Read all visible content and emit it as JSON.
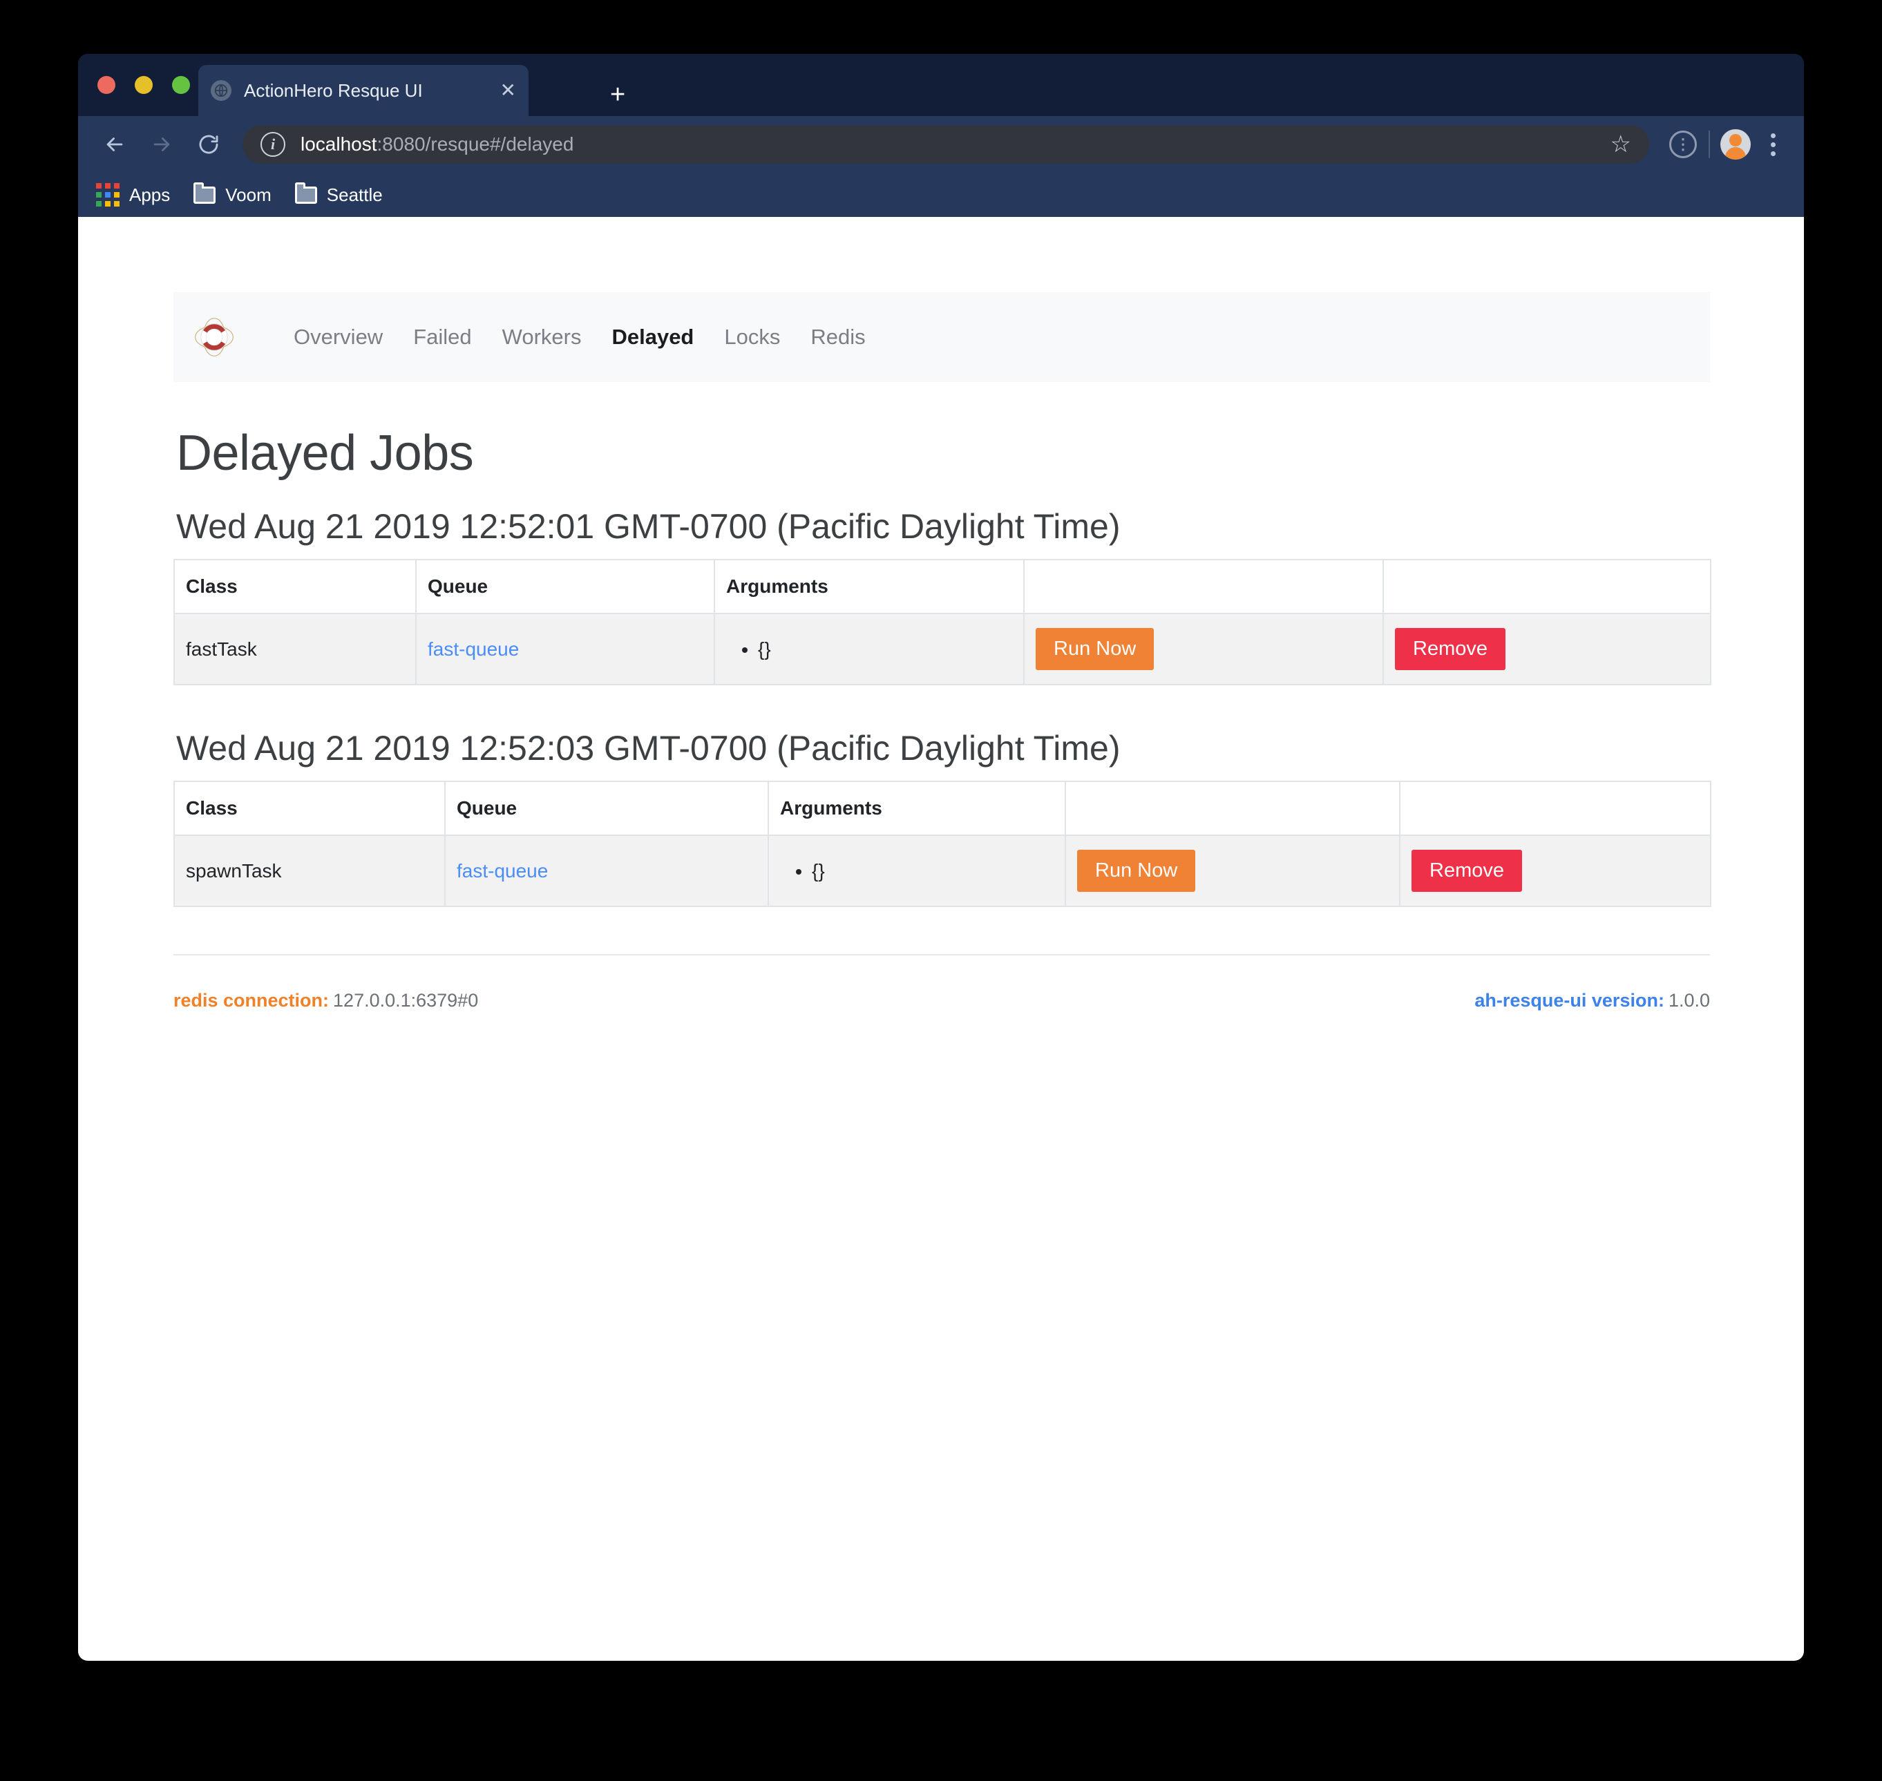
{
  "browser": {
    "tab": {
      "title": "ActionHero Resque UI",
      "favicon_icon": "globe-icon",
      "close_icon": "close-icon"
    },
    "new_tab_label": "+",
    "nav": {
      "back_icon": "arrow-left-icon",
      "forward_icon": "arrow-right-icon",
      "reload_icon": "reload-icon"
    },
    "url": {
      "info_icon": "info-icon",
      "host": "localhost",
      "rest": ":8080/resque#/delayed",
      "star_icon": "star-icon"
    },
    "toolbar_icons": {
      "extension_icon": "extension-info-icon",
      "avatar_icon": "user-avatar",
      "menu_icon": "kebab-menu-icon"
    },
    "bookmarks": [
      {
        "label": "Apps",
        "icon": "apps-grid-icon"
      },
      {
        "label": "Voom",
        "icon": "folder-icon"
      },
      {
        "label": "Seattle",
        "icon": "folder-icon"
      }
    ]
  },
  "app": {
    "brand": {
      "icon": "lifebuoy-logo"
    },
    "nav_links": [
      {
        "label": "Overview",
        "active": false
      },
      {
        "label": "Failed",
        "active": false
      },
      {
        "label": "Workers",
        "active": false
      },
      {
        "label": "Delayed",
        "active": true
      },
      {
        "label": "Locks",
        "active": false
      },
      {
        "label": "Redis",
        "active": false
      }
    ],
    "page_title": "Delayed Jobs",
    "columns": [
      "Class",
      "Queue",
      "Arguments"
    ],
    "buttons": {
      "run_now": "Run Now",
      "remove": "Remove"
    },
    "sections": [
      {
        "date": "Wed Aug 21 2019 12:52:01 GMT-0700 (Pacific Daylight Time)",
        "headers": {
          "class": "Class",
          "queue": "Queue",
          "arguments": "Arguments"
        },
        "row": {
          "class": "fastTask",
          "queue": "fast-queue",
          "arguments": [
            "{}"
          ],
          "run_now": "Run Now",
          "remove": "Remove"
        }
      },
      {
        "date": "Wed Aug 21 2019 12:52:03 GMT-0700 (Pacific Daylight Time)",
        "headers": {
          "class": "Class",
          "queue": "Queue",
          "arguments": "Arguments"
        },
        "row": {
          "class": "spawnTask",
          "queue": "fast-queue",
          "arguments": [
            "{}"
          ],
          "run_now": "Run Now",
          "remove": "Remove"
        }
      }
    ],
    "footer": {
      "redis_label": "redis connection:",
      "redis_value": "127.0.0.1:6379#0",
      "version_label": "ah-resque-ui version:",
      "version_value": "1.0.0"
    }
  },
  "colors": {
    "accent_orange": "#ef8234",
    "accent_red": "#ee3048",
    "link_blue": "#4b8df8",
    "footer_blue": "#3c82e8",
    "chrome_dark": "#121e38",
    "chrome_toolbar": "#26395c"
  }
}
